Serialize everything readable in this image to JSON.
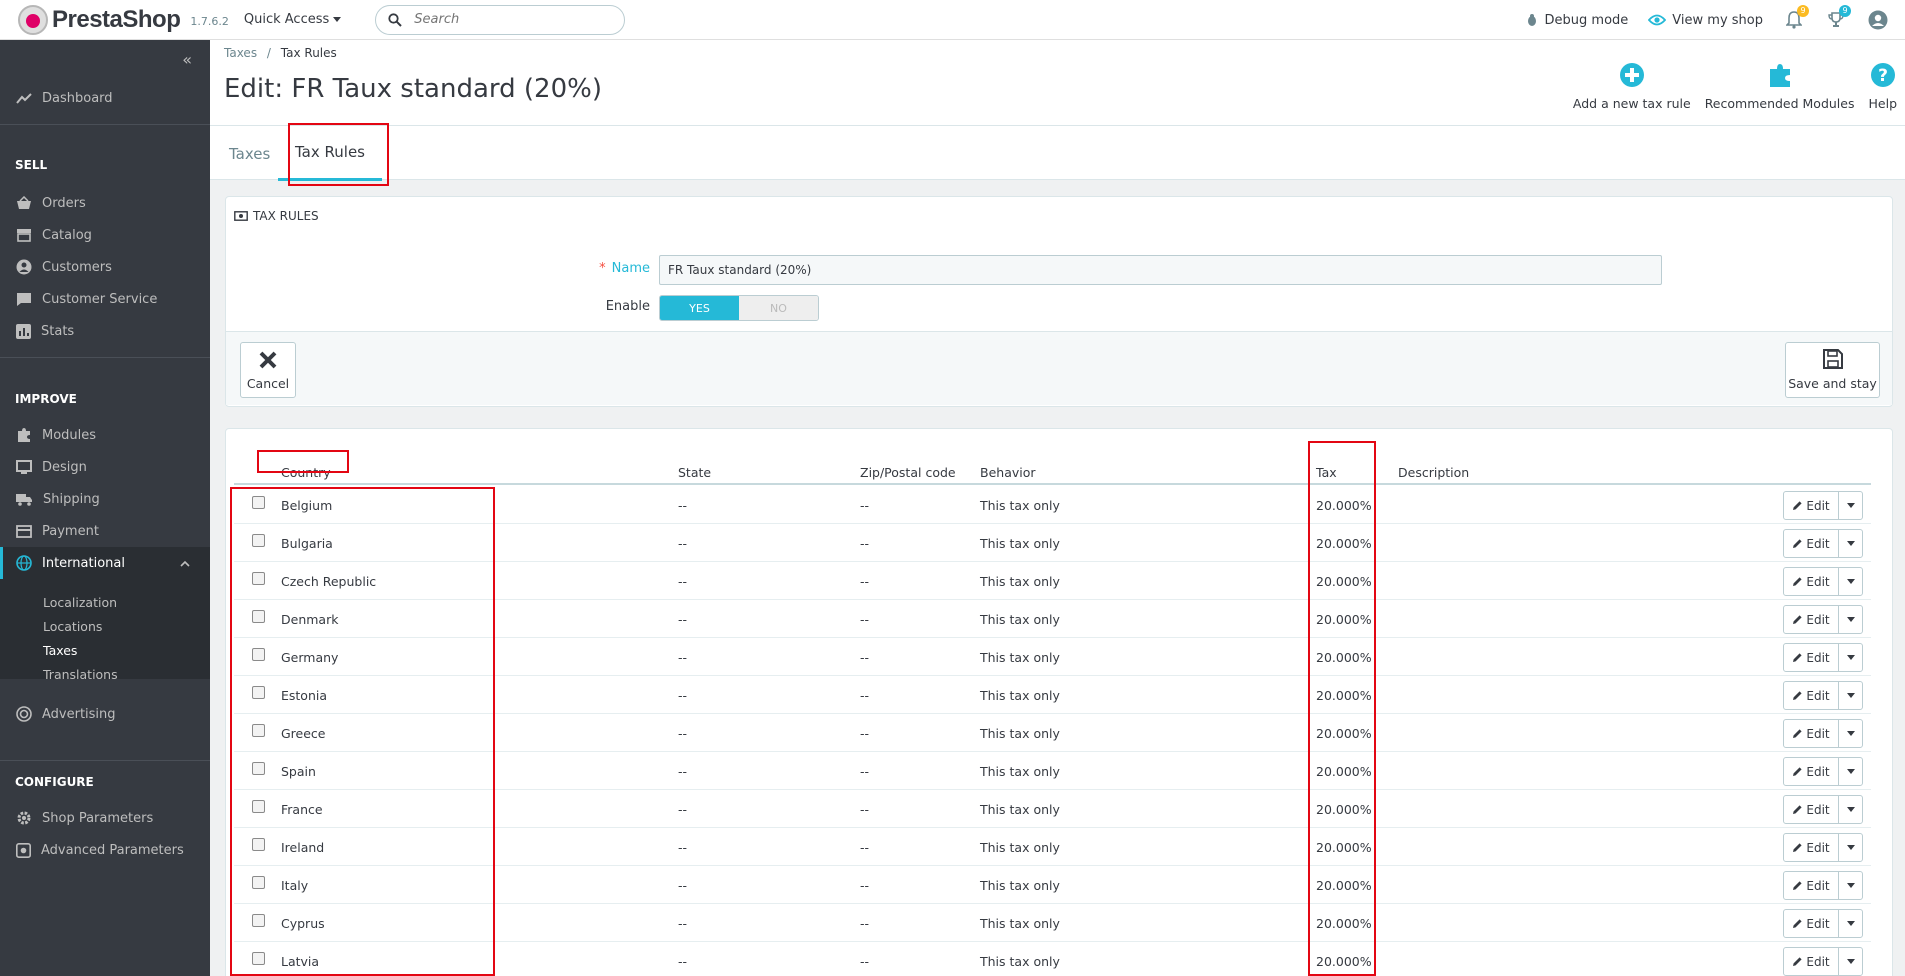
{
  "header": {
    "logo_text": "PrestaShop",
    "version": "1.7.6.2",
    "quick_access": "Quick Access",
    "search_placeholder": "Search",
    "debug_mode": "Debug mode",
    "view_shop": "View my shop",
    "notif_count_orders": "9",
    "notif_count_customers": "9"
  },
  "sidebar": {
    "dashboard": "Dashboard",
    "sell": "SELL",
    "orders": "Orders",
    "catalog": "Catalog",
    "customers": "Customers",
    "customer_service": "Customer Service",
    "stats": "Stats",
    "improve": "IMPROVE",
    "modules": "Modules",
    "design": "Design",
    "shipping": "Shipping",
    "payment": "Payment",
    "international": "International",
    "sub": [
      "Localization",
      "Locations",
      "Taxes",
      "Translations"
    ],
    "advertising": "Advertising",
    "configure": "CONFIGURE",
    "shop_parameters": "Shop Parameters",
    "advanced_parameters": "Advanced Parameters"
  },
  "page": {
    "breadcrumb_parent": "Taxes",
    "breadcrumb_sep": "/",
    "breadcrumb_current": "Tax Rules",
    "title": "Edit: FR Taux standard (20%)",
    "toolbar": {
      "add": "Add a new tax rule",
      "modules": "Recommended Modules",
      "help": "Help"
    },
    "tabs": [
      "Taxes",
      "Tax Rules"
    ]
  },
  "form": {
    "panel_title": "TAX RULES",
    "name_label": "Name",
    "required_mark": "*",
    "name_value": "FR Taux standard (20%)",
    "enable_label": "Enable",
    "yes": "YES",
    "no": "NO",
    "cancel": "Cancel",
    "save_stay": "Save and stay"
  },
  "table": {
    "headers": {
      "country": "Country",
      "state": "State",
      "zip": "Zip/Postal code",
      "behavior": "Behavior",
      "tax": "Tax",
      "description": "Description"
    },
    "edit_label": "Edit",
    "rows": [
      {
        "country": "Belgium",
        "state": "--",
        "zip": "--",
        "behavior": "This tax only",
        "tax": "20.000%"
      },
      {
        "country": "Bulgaria",
        "state": "--",
        "zip": "--",
        "behavior": "This tax only",
        "tax": "20.000%"
      },
      {
        "country": "Czech Republic",
        "state": "--",
        "zip": "--",
        "behavior": "This tax only",
        "tax": "20.000%"
      },
      {
        "country": "Denmark",
        "state": "--",
        "zip": "--",
        "behavior": "This tax only",
        "tax": "20.000%"
      },
      {
        "country": "Germany",
        "state": "--",
        "zip": "--",
        "behavior": "This tax only",
        "tax": "20.000%"
      },
      {
        "country": "Estonia",
        "state": "--",
        "zip": "--",
        "behavior": "This tax only",
        "tax": "20.000%"
      },
      {
        "country": "Greece",
        "state": "--",
        "zip": "--",
        "behavior": "This tax only",
        "tax": "20.000%"
      },
      {
        "country": "Spain",
        "state": "--",
        "zip": "--",
        "behavior": "This tax only",
        "tax": "20.000%"
      },
      {
        "country": "France",
        "state": "--",
        "zip": "--",
        "behavior": "This tax only",
        "tax": "20.000%"
      },
      {
        "country": "Ireland",
        "state": "--",
        "zip": "--",
        "behavior": "This tax only",
        "tax": "20.000%"
      },
      {
        "country": "Italy",
        "state": "--",
        "zip": "--",
        "behavior": "This tax only",
        "tax": "20.000%"
      },
      {
        "country": "Cyprus",
        "state": "--",
        "zip": "--",
        "behavior": "This tax only",
        "tax": "20.000%"
      },
      {
        "country": "Latvia",
        "state": "--",
        "zip": "--",
        "behavior": "This tax only",
        "tax": "20.000%"
      }
    ]
  },
  "colors": {
    "accent": "#25b9d7",
    "sidebar": "#363a41",
    "highlight": "#e30613",
    "badge": "#fbbb22"
  }
}
